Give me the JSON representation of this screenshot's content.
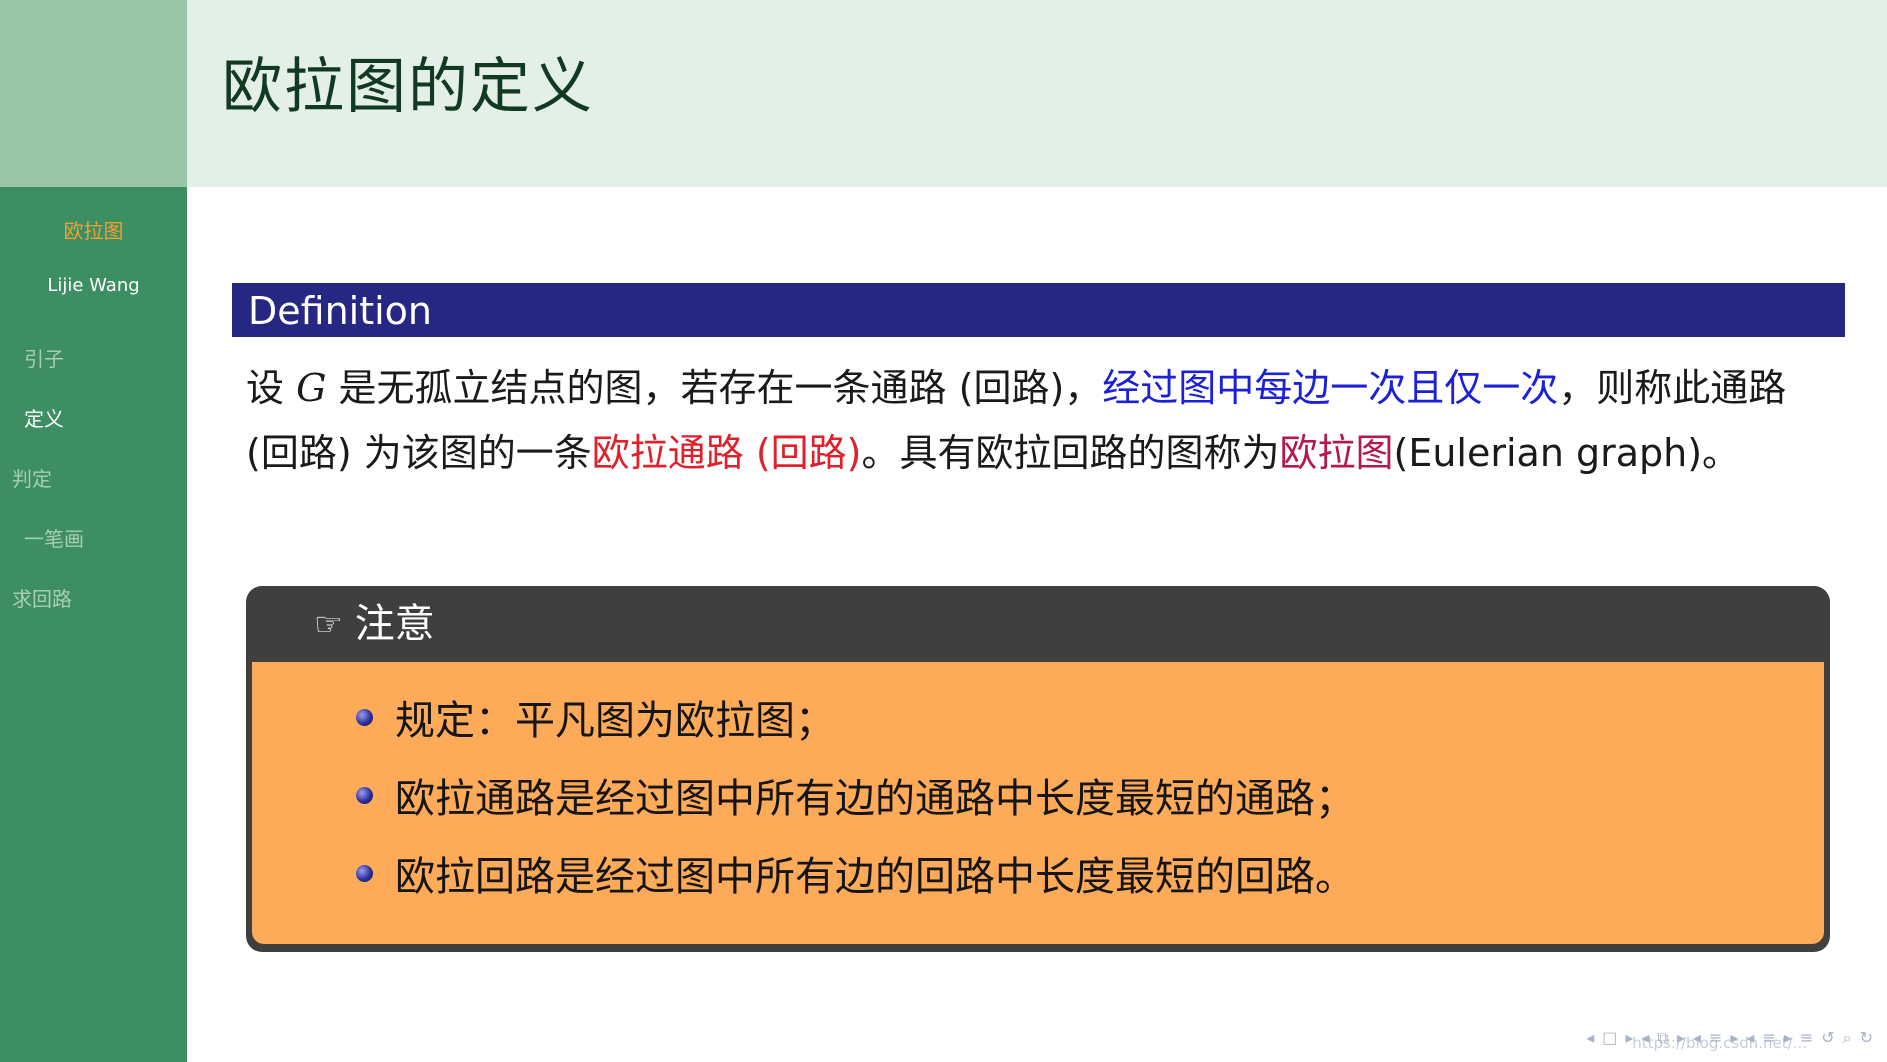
{
  "sidebar": {
    "title": "欧拉图",
    "author": "Lijie Wang",
    "items": [
      {
        "label": "引子",
        "active": false
      },
      {
        "label": "定义",
        "active": true
      },
      {
        "label": "判定",
        "active": false
      },
      {
        "label": "一笔画",
        "active": false
      },
      {
        "label": "求回路",
        "active": false
      }
    ]
  },
  "header": {
    "title": "欧拉图的定义"
  },
  "definition": {
    "heading": "Definition",
    "p1": "设 ",
    "g": "G",
    "p2": " 是无孤立结点的图，若存在一条通路 (回路)，",
    "blue": "经过图中每边一次且仅一次",
    "p3": "，则称此通路 (回路) 为该图的一条",
    "red": "欧拉通路 (回路)",
    "p4": "。具有欧拉回路的图称为",
    "crimson": "欧拉图",
    "p5": "(Eulerian graph)。"
  },
  "note": {
    "hand_icon": "☞",
    "heading": "注意",
    "bullets": [
      "规定：平凡图为欧拉图；",
      "欧拉通路是经过图中所有边的通路中长度最短的通路；",
      "欧拉回路是经过图中所有边的回路中长度最短的回路。"
    ]
  },
  "nav": {
    "icons": [
      "◂",
      "□",
      "▸",
      "◂",
      "⧉",
      "▸",
      "◂",
      "≡",
      "▸",
      "◂",
      "≡",
      "▸",
      "≡",
      "↺",
      "⌕",
      "↻"
    ]
  },
  "watermark": "https://blog.csdn.net/..."
}
